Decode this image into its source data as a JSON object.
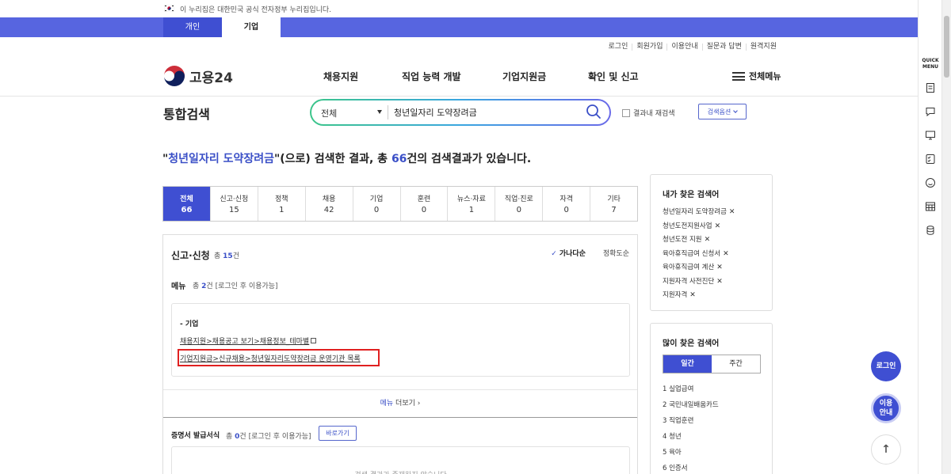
{
  "gov_banner": {
    "text": "이 누리집은 대한민국 공식 전자정부 누리집입니다."
  },
  "top_tabs": [
    "개인",
    "기업"
  ],
  "util_links": [
    "로그인",
    "회원가입",
    "이용안내",
    "질문과 답변",
    "원격지원"
  ],
  "logo": {
    "text": "고용24"
  },
  "gnb": [
    "채용지원",
    "직업 능력 개발",
    "기업지원금",
    "확인 및 신고"
  ],
  "all_menu": "전체메뉴",
  "search": {
    "title": "통합검색",
    "scope": "전체",
    "query": "청년일자리 도약장려금",
    "re_search": "결과내 재검색",
    "options_button": "검색옵션"
  },
  "headline": {
    "quote_open": "\"",
    "keyword": "청년일자리 도약장려금",
    "middle": "\"(으로) 검색한 결과, 총 ",
    "count": "66",
    "suffix": "건의 검색결과가 있습니다."
  },
  "categories": [
    {
      "label": "전체",
      "count": "66"
    },
    {
      "label": "신고·신청",
      "count": "15"
    },
    {
      "label": "정책",
      "count": "1"
    },
    {
      "label": "채용",
      "count": "42"
    },
    {
      "label": "기업",
      "count": "0"
    },
    {
      "label": "훈련",
      "count": "0"
    },
    {
      "label": "뉴스·자료",
      "count": "1"
    },
    {
      "label": "직업·진로",
      "count": "0"
    },
    {
      "label": "자격",
      "count": "0"
    },
    {
      "label": "기타",
      "count": "7"
    }
  ],
  "panel": {
    "title": "신고·신청",
    "total_prefix": "총 ",
    "total_count": "15",
    "total_suffix": "건",
    "sort_a": "가나다순",
    "sort_b": "정확도순",
    "menu_label": "메뉴",
    "menu_total_prefix": "총 ",
    "menu_total_count": "2",
    "menu_total_suffix": "건 [로그인 후 이용가능]",
    "group": "- 기업",
    "link1": "채용지원>채용공고 보기>채용정보_테마별",
    "link2": "기업지원금>신규채용>청년일자리도약장려금 운영기관 목록",
    "more_prefix": "메뉴",
    "more_suffix": " 더보기 ›",
    "cert_label": "증명서 발급서식",
    "cert_total_prefix": "총 ",
    "cert_total_count": "0",
    "cert_total_suffix": "건 [로그인 후 이용가능]",
    "go_button": "바로가기",
    "empty_text": "검색 결과가 존재하지 않습니다"
  },
  "my_keywords": {
    "title": "내가 찾은 검색어",
    "items": [
      "청년일자리 도약장려금",
      "청년도전지원사업",
      "청년도전 지원",
      "육아휴직급여 신청서",
      "육아휴직급여 계산",
      "지원자격 사전진단",
      "지원자격"
    ]
  },
  "popular": {
    "title": "많이 찾은 검색어",
    "tabs": [
      "일간",
      "주간"
    ],
    "items": [
      "1 실업급여",
      "2 국민내일배움카드",
      "3 직업훈련",
      "4 청년",
      "5 육아",
      "6 인증서"
    ]
  },
  "quick_menu": {
    "label": "QUICK MENU"
  },
  "fabs": {
    "login": "로그인",
    "guide": "이용 안내",
    "top": "↑"
  },
  "colors": {
    "primary": "#3f4fd2",
    "band": "#5765e0",
    "highlight": "#e02020"
  }
}
